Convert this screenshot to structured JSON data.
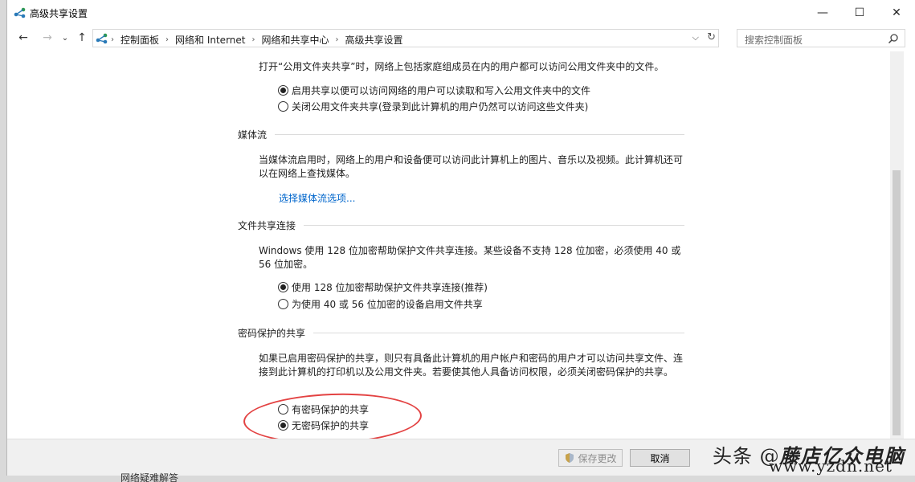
{
  "window": {
    "title": "高级共享设置",
    "min_label": "—",
    "max_label": "☐",
    "close_label": "✕"
  },
  "nav": {
    "back_icon": "←",
    "forward_icon": "→",
    "recent_icon": "⌄",
    "up_icon": "↑",
    "breadcrumb": [
      "控制面板",
      "网络和 Internet",
      "网络和共享中心",
      "高级共享设置"
    ],
    "sep": "›",
    "dropdown": "⌵",
    "refresh": "↻",
    "search_placeholder": "搜索控制面板"
  },
  "public_folder": {
    "description": "打开“公用文件夹共享”时，网络上包括家庭组成员在内的用户都可以访问公用文件夹中的文件。",
    "options": [
      {
        "label": "启用共享以便可以访问网络的用户可以读取和写入公用文件夹中的文件",
        "checked": true
      },
      {
        "label": "关闭公用文件夹共享(登录到此计算机的用户仍然可以访问这些文件夹)",
        "checked": false
      }
    ]
  },
  "media": {
    "heading": "媒体流",
    "description": "当媒体流启用时，网络上的用户和设备便可以访问此计算机上的图片、音乐以及视频。此计算机还可以在网络上查找媒体。",
    "link": "选择媒体流选项..."
  },
  "file_sharing": {
    "heading": "文件共享连接",
    "description": "Windows 使用 128 位加密帮助保护文件共享连接。某些设备不支持 128 位加密，必须使用 40 或 56 位加密。",
    "options": [
      {
        "label": "使用 128 位加密帮助保护文件共享连接(推荐)",
        "checked": true
      },
      {
        "label": "为使用 40 或 56 位加密的设备启用文件共享",
        "checked": false
      }
    ]
  },
  "password": {
    "heading": "密码保护的共享",
    "description": "如果已启用密码保护的共享，则只有具备此计算机的用户帐户和密码的用户才可以访问共享文件、连接到此计算机的打印机以及公用文件夹。若要使其他人具备访问权限，必须关闭密码保护的共享。",
    "options": [
      {
        "label": "有密码保护的共享",
        "checked": false
      },
      {
        "label": "无密码保护的共享",
        "checked": true
      }
    ]
  },
  "footer": {
    "save_label": "保存更改",
    "cancel_label": "取消"
  },
  "watermark": {
    "prefix": "头条 @",
    "brand": "藤店亿众电脑",
    "url": "www.yzdn.net"
  },
  "background_text": "网络疑难解答",
  "colors": {
    "link": "#0066cc",
    "highlight": "#e34242"
  }
}
